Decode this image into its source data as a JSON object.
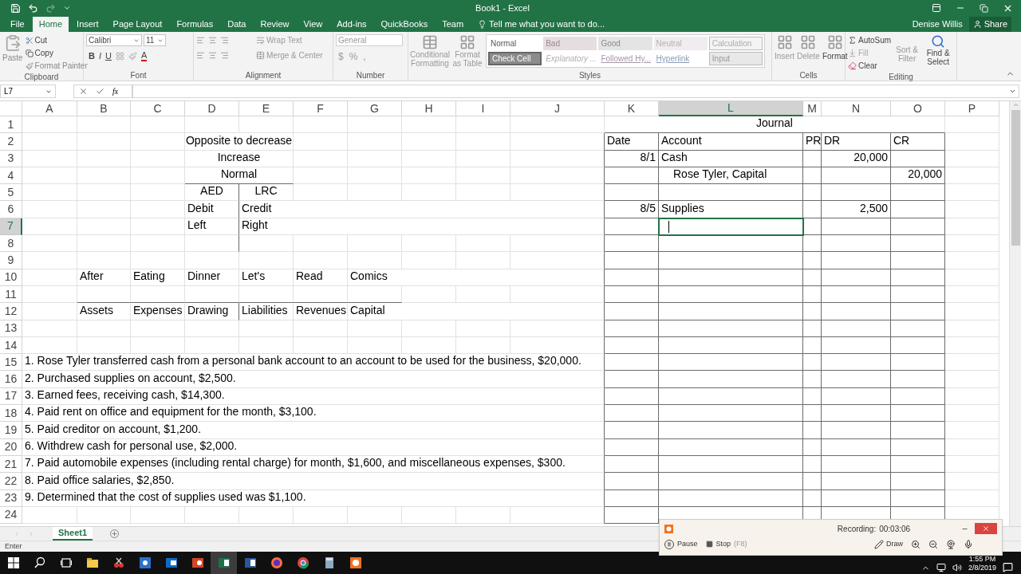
{
  "title_bar": {
    "title": "Book1 - Excel",
    "user": "Denise Willis",
    "share": "Share"
  },
  "ribbon_tabs": [
    {
      "label": "File",
      "selected": false
    },
    {
      "label": "Home",
      "selected": true
    },
    {
      "label": "Insert",
      "selected": false
    },
    {
      "label": "Page Layout",
      "selected": false
    },
    {
      "label": "Formulas",
      "selected": false
    },
    {
      "label": "Data",
      "selected": false
    },
    {
      "label": "Review",
      "selected": false
    },
    {
      "label": "View",
      "selected": false
    },
    {
      "label": "Add-ins",
      "selected": false
    },
    {
      "label": "QuickBooks",
      "selected": false
    },
    {
      "label": "Team",
      "selected": false
    }
  ],
  "tell_me": "Tell me what you want to do...",
  "clipboard": {
    "paste": "Paste",
    "cut": "Cut",
    "copy": "Copy",
    "format_painter": "Format Painter",
    "label": "Clipboard"
  },
  "font": {
    "name": "Calibri",
    "size": "11",
    "bold": "B",
    "italic": "I",
    "underline": "U",
    "color_letter": "A",
    "label": "Font"
  },
  "alignment": {
    "wrap": "Wrap Text",
    "merge": "Merge & Center",
    "label": "Alignment"
  },
  "number": {
    "format": "General",
    "currency": "$",
    "percent": "%",
    "comma": ",",
    "label": "Number"
  },
  "styles": {
    "conditional": "Conditional Formatting",
    "format_table": "Format as Table",
    "label": "Styles",
    "gallery": [
      {
        "label": "Normal",
        "kind": "normal"
      },
      {
        "label": "Bad",
        "kind": "bad"
      },
      {
        "label": "Good",
        "kind": "good"
      },
      {
        "label": "Neutral",
        "kind": "neutral"
      },
      {
        "label": "Calculation",
        "kind": "calculation"
      },
      {
        "label": "Check Cell",
        "kind": "check"
      },
      {
        "label": "Explanatory ...",
        "kind": "explanatory"
      },
      {
        "label": "Followed Hy...",
        "kind": "followed"
      },
      {
        "label": "Hyperlink",
        "kind": "hyperlink"
      },
      {
        "label": "Input",
        "kind": "input"
      }
    ]
  },
  "cells_group": {
    "insert": "Insert",
    "delete": "Delete",
    "format": "Format",
    "label": "Cells"
  },
  "editing": {
    "autosum": "AutoSum",
    "fill": "Fill",
    "clear": "Clear",
    "sort": "Sort & Filter",
    "find": "Find & Select",
    "label": "Editing"
  },
  "formula_bar": {
    "name_box": "L7",
    "fx": "fx"
  },
  "columns": [
    {
      "label": "A",
      "selected": false
    },
    {
      "label": "B",
      "selected": false
    },
    {
      "label": "C",
      "selected": false
    },
    {
      "label": "D",
      "selected": false
    },
    {
      "label": "E",
      "selected": false
    },
    {
      "label": "F",
      "selected": false
    },
    {
      "label": "G",
      "selected": false
    },
    {
      "label": "H",
      "selected": false
    },
    {
      "label": "I",
      "selected": false
    },
    {
      "label": "J",
      "selected": false
    },
    {
      "label": "K",
      "selected": false
    },
    {
      "label": "L",
      "selected": true
    },
    {
      "label": "M",
      "selected": false
    },
    {
      "label": "N",
      "selected": false
    },
    {
      "label": "O",
      "selected": false
    },
    {
      "label": "P",
      "selected": false
    }
  ],
  "rows": [
    {
      "number": "1",
      "selected": false,
      "cells": [
        {
          "kind": "empty"
        },
        {
          "kind": "empty"
        },
        {
          "kind": "empty"
        },
        {
          "kind": "empty"
        },
        {
          "kind": "empty"
        },
        {
          "kind": "empty"
        },
        {
          "kind": "empty"
        },
        {
          "kind": "empty"
        },
        {
          "kind": "empty"
        },
        {
          "kind": "empty"
        },
        {
          "kind": "center",
          "text": "Journal"
        },
        {
          "kind": "merged"
        },
        {
          "kind": "merged"
        },
        {
          "kind": "merged"
        },
        {
          "kind": "merged"
        }
      ]
    },
    {
      "number": "2",
      "selected": false,
      "cells": [
        {
          "kind": "empty"
        },
        {
          "kind": "empty"
        },
        {
          "kind": "empty"
        },
        {
          "kind": "center",
          "text": "Opposite to decrease"
        },
        {
          "kind": "merged"
        },
        {
          "kind": "empty"
        },
        {
          "kind": "empty"
        },
        {
          "kind": "empty"
        },
        {
          "kind": "empty"
        },
        {
          "kind": "empty"
        },
        {
          "kind": "text",
          "text": "Date"
        },
        {
          "kind": "text",
          "text": "Account"
        },
        {
          "kind": "text",
          "text": "PR"
        },
        {
          "kind": "text",
          "text": "DR"
        },
        {
          "kind": "text",
          "text": "CR"
        }
      ]
    },
    {
      "number": "3",
      "selected": false,
      "cells": [
        {
          "kind": "empty"
        },
        {
          "kind": "empty"
        },
        {
          "kind": "empty"
        },
        {
          "kind": "center",
          "text": "Increase"
        },
        {
          "kind": "merged"
        },
        {
          "kind": "empty"
        },
        {
          "kind": "empty"
        },
        {
          "kind": "empty"
        },
        {
          "kind": "empty"
        },
        {
          "kind": "empty"
        },
        {
          "kind": "number",
          "text": "8/1"
        },
        {
          "kind": "text",
          "text": "Cash"
        },
        {
          "kind": "empty"
        },
        {
          "kind": "number",
          "text": "20,000"
        }
      ]
    },
    {
      "number": "4",
      "selected": false,
      "cells": [
        {
          "kind": "empty"
        },
        {
          "kind": "empty"
        },
        {
          "kind": "empty"
        },
        {
          "kind": "center",
          "text": "Normal"
        },
        {
          "kind": "merged"
        },
        {
          "kind": "empty"
        },
        {
          "kind": "empty"
        },
        {
          "kind": "empty"
        },
        {
          "kind": "empty"
        },
        {
          "kind": "empty"
        },
        {
          "kind": "empty"
        },
        {
          "kind": "indent",
          "text": "Rose Tyler, Capital"
        },
        {
          "kind": "empty"
        },
        {
          "kind": "empty"
        },
        {
          "kind": "number",
          "text": "20,000"
        }
      ]
    },
    {
      "number": "5",
      "selected": false,
      "cells": [
        {
          "kind": "empty"
        },
        {
          "kind": "empty"
        },
        {
          "kind": "empty"
        },
        {
          "kind": "center",
          "text": "AED"
        },
        {
          "kind": "center",
          "text": "LRC"
        }
      ]
    },
    {
      "number": "6",
      "selected": false,
      "cells": [
        {
          "kind": "empty"
        },
        {
          "kind": "empty"
        },
        {
          "kind": "empty"
        },
        {
          "kind": "text",
          "text": "Debit"
        },
        {
          "kind": "text",
          "text": "Credit"
        },
        {
          "kind": "empty"
        },
        {
          "kind": "empty"
        },
        {
          "kind": "empty"
        },
        {
          "kind": "empty"
        },
        {
          "kind": "empty"
        },
        {
          "kind": "number",
          "text": "8/5"
        },
        {
          "kind": "text",
          "text": "Supplies"
        },
        {
          "kind": "empty"
        },
        {
          "kind": "number",
          "text": "2,500"
        }
      ]
    },
    {
      "number": "7",
      "selected": true,
      "cells": [
        {
          "kind": "empty"
        },
        {
          "kind": "empty"
        },
        {
          "kind": "empty"
        },
        {
          "kind": "text",
          "text": "Left"
        },
        {
          "kind": "text",
          "text": "Right"
        },
        {
          "kind": "empty"
        },
        {
          "kind": "empty"
        },
        {
          "kind": "empty"
        },
        {
          "kind": "empty"
        },
        {
          "kind": "empty"
        },
        {
          "kind": "empty"
        },
        {
          "kind": "active"
        }
      ]
    },
    {
      "number": "8",
      "selected": false,
      "cells": []
    },
    {
      "number": "9",
      "selected": false,
      "cells": []
    },
    {
      "number": "10",
      "selected": false,
      "cells": [
        {
          "kind": "empty"
        },
        {
          "kind": "text",
          "text": "After"
        },
        {
          "kind": "text",
          "text": "Eating"
        },
        {
          "kind": "text",
          "text": "Dinner"
        },
        {
          "kind": "text",
          "text": "Let's"
        },
        {
          "kind": "text",
          "text": "Read"
        },
        {
          "kind": "text",
          "text": "Comics"
        }
      ]
    },
    {
      "number": "11",
      "selected": false,
      "cells": []
    },
    {
      "number": "12",
      "selected": false,
      "cells": [
        {
          "kind": "empty"
        },
        {
          "kind": "text",
          "text": "Assets"
        },
        {
          "kind": "text",
          "text": "Expenses"
        },
        {
          "kind": "text",
          "text": "Drawing"
        },
        {
          "kind": "text",
          "text": "Liabilities"
        },
        {
          "kind": "text",
          "text": "Revenues"
        },
        {
          "kind": "text",
          "text": "Capital"
        }
      ]
    },
    {
      "number": "13",
      "selected": false,
      "cells": []
    },
    {
      "number": "14",
      "selected": false,
      "cells": []
    },
    {
      "number": "15",
      "selected": false,
      "cells": [
        {
          "kind": "text",
          "text": "1. Rose Tyler transferred cash from a personal bank account to an account to be used for the business, $20,000."
        }
      ]
    },
    {
      "number": "16",
      "selected": false,
      "cells": [
        {
          "kind": "text",
          "text": "2. Purchased supplies on account, $2,500."
        }
      ]
    },
    {
      "number": "17",
      "selected": false,
      "cells": [
        {
          "kind": "text",
          "text": "3. Earned fees, receiving cash, $14,300."
        }
      ]
    },
    {
      "number": "18",
      "selected": false,
      "cells": [
        {
          "kind": "text",
          "text": "4. Paid rent on office and equipment for the month, $3,100."
        }
      ]
    },
    {
      "number": "19",
      "selected": false,
      "cells": [
        {
          "kind": "text",
          "text": "5. Paid creditor on account, $1,200."
        }
      ]
    },
    {
      "number": "20",
      "selected": false,
      "cells": [
        {
          "kind": "text",
          "text": "6. Withdrew cash for personal use, $2,000."
        }
      ]
    },
    {
      "number": "21",
      "selected": false,
      "cells": [
        {
          "kind": "text",
          "text": "7. Paid automobile expenses (including rental charge) for month, $1,600, and miscellaneous expenses, $300."
        }
      ]
    },
    {
      "number": "22",
      "selected": false,
      "cells": [
        {
          "kind": "text",
          "text": "8. Paid office salaries, $2,850."
        }
      ]
    },
    {
      "number": "23",
      "selected": false,
      "cells": [
        {
          "kind": "text",
          "text": "9. Determined that the cost of supplies used was $1,100."
        }
      ]
    },
    {
      "number": "24",
      "selected": false,
      "cells": []
    }
  ],
  "sheet_tabs": [
    {
      "label": "Sheet1",
      "selected": true
    }
  ],
  "status": "Enter",
  "recorder": {
    "status": "Recording:",
    "time": "00:03:06",
    "pause": "Pause",
    "stop": "Stop",
    "shortcut": "(F8)",
    "draw": "Draw"
  },
  "clock": {
    "time": "1:55 PM",
    "date": "2/8/2019"
  }
}
